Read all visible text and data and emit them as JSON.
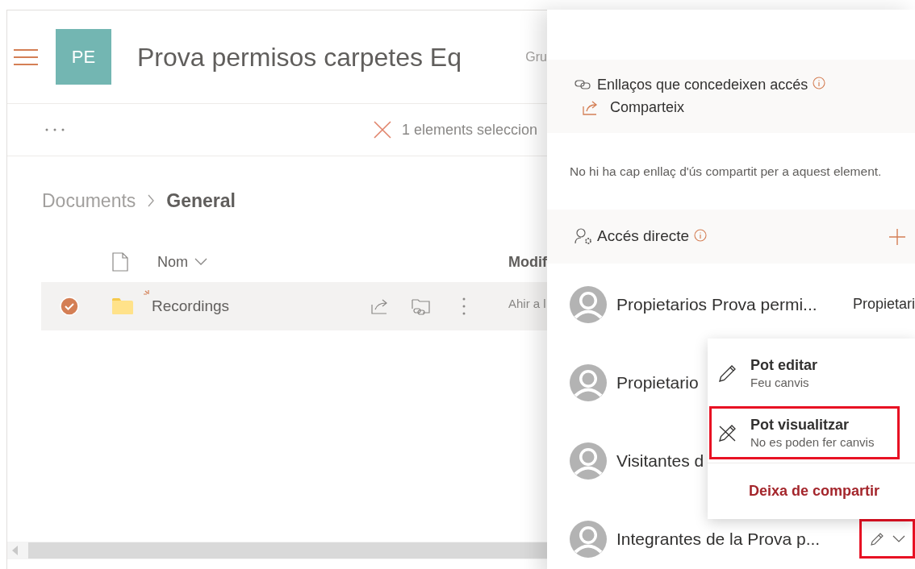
{
  "site": {
    "logo_initials": "PE",
    "title": "Prova permisos carpetes Eq",
    "group_label": "Gru"
  },
  "toolbar": {
    "selection": "1 elements seleccion"
  },
  "breadcrumb": [
    {
      "label": "Documents",
      "current": false
    },
    {
      "label": "General",
      "current": true
    }
  ],
  "columns": [
    "Nom",
    "Modif"
  ],
  "rows": [
    {
      "name": "Recordings",
      "selected": true,
      "is_new": true,
      "modified": "Ahir a l"
    }
  ],
  "share_panel": {
    "links_heading": "Enllaços que concedeixen accés",
    "share_button": "Comparteix",
    "no_links_text": "No hi ha cap enllaç d'ús compartit per a aquest element.",
    "direct_access_heading": "Accés directe",
    "people": [
      {
        "name": "Propietarios Prova permi...",
        "role": "Propietari"
      },
      {
        "name": "Propietario"
      },
      {
        "name": "Visitantes d"
      },
      {
        "name": "Integrantes de la Prova p...",
        "permission_control": {
          "highlighted": true
        }
      }
    ]
  },
  "permission_menu": {
    "items": [
      {
        "kind": "edit",
        "title": "Pot editar",
        "subtitle": "Feu canvis",
        "highlighted": false
      },
      {
        "kind": "view",
        "title": "Pot visualitzar",
        "subtitle": "No es poden fer canvis",
        "highlighted": true
      },
      {
        "kind": "remove",
        "title": "Deixa de compartir",
        "highlighted": false
      }
    ]
  }
}
